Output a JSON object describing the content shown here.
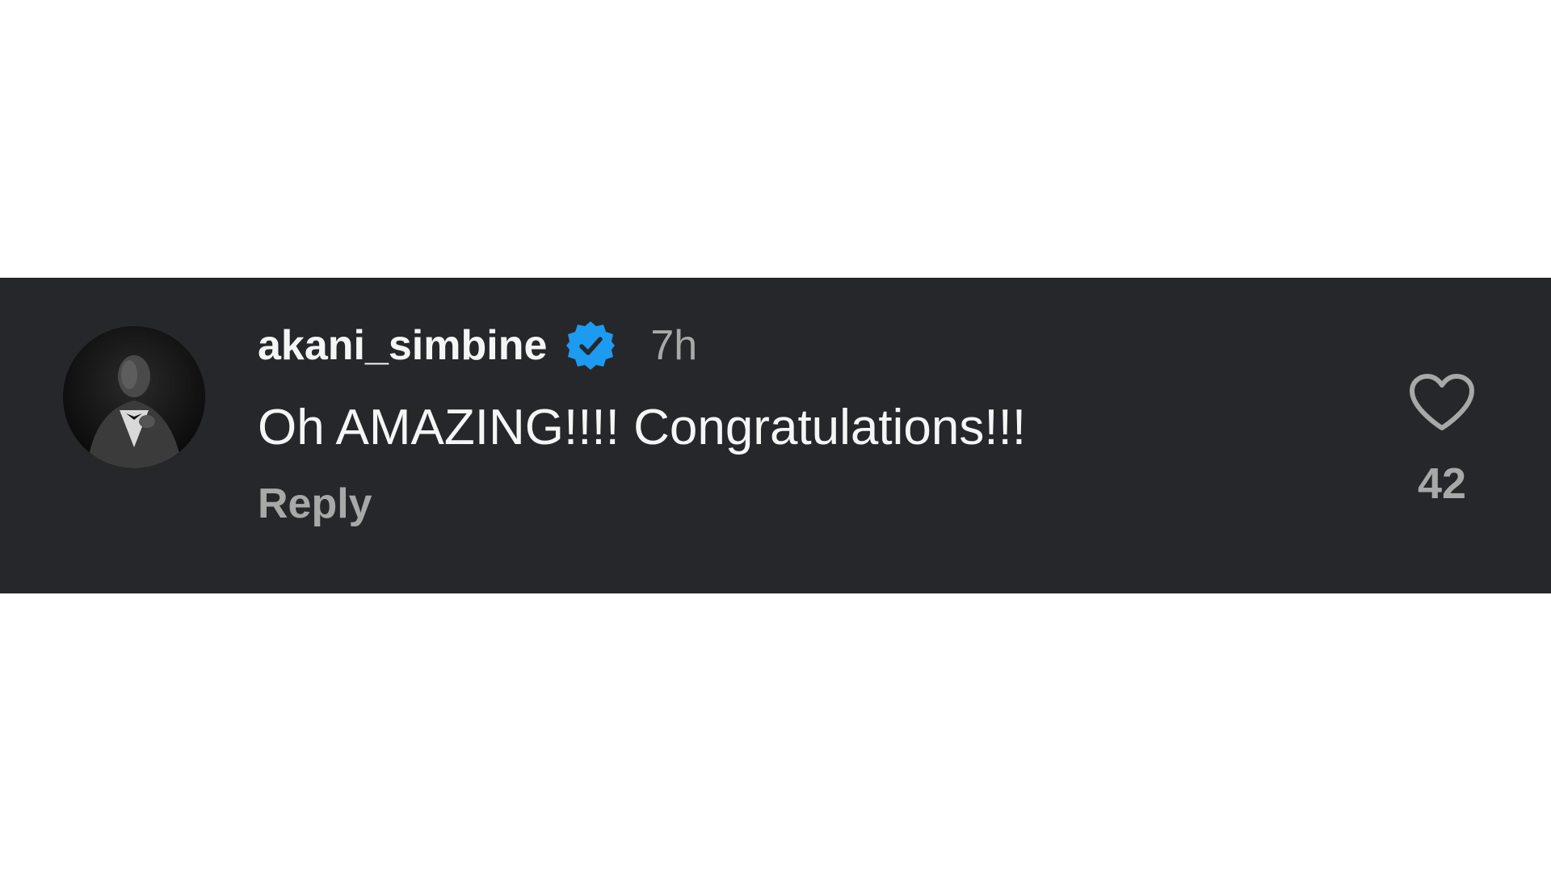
{
  "comment": {
    "username": "akani_simbine",
    "verified_icon": "verified-badge-icon",
    "timestamp": "7h",
    "text": "Oh AMAZING!!!! Congratulations!!!",
    "reply_label": "Reply",
    "like_icon": "heart-outline-icon",
    "like_count": "42"
  },
  "colors": {
    "background": "#26272b",
    "primary_text": "#f5f5f5",
    "secondary_text": "#a8a8a8",
    "verified_blue": "#1d9bf0"
  }
}
